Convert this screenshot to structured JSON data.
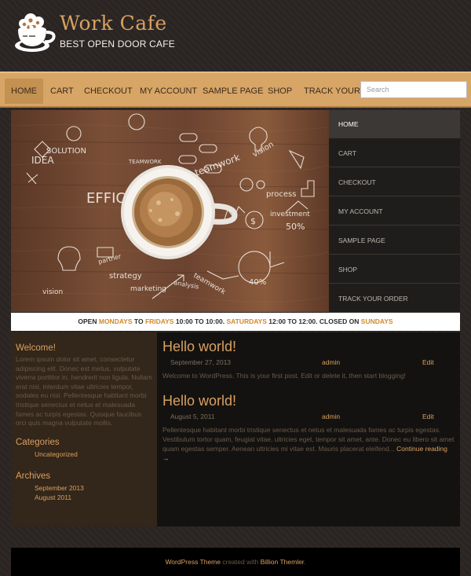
{
  "header": {
    "site_title": "Work Cafe",
    "tagline": "BEST OPEN DOOR CAFE"
  },
  "nav": {
    "items": [
      {
        "label": "HOME"
      },
      {
        "label": "CART"
      },
      {
        "label": "CHECKOUT"
      },
      {
        "label": "MY ACCOUNT"
      },
      {
        "label": "SAMPLE PAGE"
      },
      {
        "label": "SHOP"
      },
      {
        "label": "TRACK YOUR OR"
      }
    ],
    "search_placeholder": "Search"
  },
  "hero": {
    "words": [
      "SOLUTION",
      "IDEA",
      "TEAMWORK",
      "teamwork",
      "vision",
      "EFFIC",
      "process",
      "investment",
      "50%",
      "partner",
      "strategy",
      "marketing",
      "analysis",
      "teamwork",
      "40%",
      "vision"
    ]
  },
  "side_menu": {
    "items": [
      {
        "label": "HOME"
      },
      {
        "label": "CART"
      },
      {
        "label": "CHECKOUT"
      },
      {
        "label": "MY ACCOUNT"
      },
      {
        "label": "SAMPLE PAGE"
      },
      {
        "label": "SHOP"
      },
      {
        "label": "TRACK YOUR ORDER"
      }
    ]
  },
  "hours": {
    "open": "OPEN",
    "mon": "MONDAYS",
    "to1": "TO",
    "fri": "FRIDAYS",
    "weekday_time": "10:00 TO 10:00.",
    "sat": "SATURDAYS",
    "sat_time": "12:00 TO 12:00.",
    "closed": "CLOSED ON",
    "sun": "SUNDAYS"
  },
  "sidebar": {
    "welcome_title": "Welcome!",
    "welcome_text": "Lorem ipsum dolor sit amet, consectetur adipiscing elit. Donec est metus, vulputate viverra porttitor in, hendrerit non ligula. Nullam erat nisl, interdum vitae ultricies tempor, sodales eu nisl. Pellentesque habitant morbi tristique senectus et netus et malesuada fames ac turpis egestas. Quisque faucibus orci quis magna vulputate mollis.",
    "categories_title": "Categories",
    "categories": [
      "Uncategorized"
    ],
    "archives_title": "Archives",
    "archives": [
      "September 2013",
      "August 2011"
    ]
  },
  "posts": [
    {
      "title": "Hello world!",
      "date": "September 27, 2013",
      "author": "admin",
      "edit": "Edit",
      "body": "Welcome to WordPress. This is your first post. Edit or delete it, then start blogging!",
      "more": ""
    },
    {
      "title": "Hello world!",
      "date": "August 5, 2011",
      "author": "admin",
      "edit": "Edit",
      "body": "Pellentesque habitant morbi tristique senectus et netus et malesuada fames ac turpis egestas. Vestibulum tortor quam, feugiat vitae, ultricies eget, tempor sit amet, ante. Donec eu libero sit amet quam egestas semper. Aenean ultricies mi vitae est. Mauris placerat eleifend...",
      "more": "Continue reading →"
    }
  ],
  "footer": {
    "theme_link": "WordPress Theme",
    "created": "created with",
    "themer_link": "Billion Themler",
    "dot": "."
  },
  "colors": {
    "accent": "#d9a060",
    "nav_bg": "#d7a566",
    "background": "#2a2523"
  }
}
